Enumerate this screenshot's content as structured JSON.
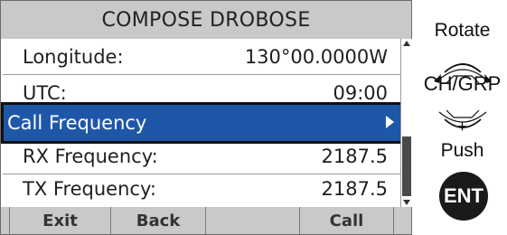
{
  "screen": {
    "title": "COMPOSE DROBOSE",
    "rows": [
      {
        "label": "Longitude:",
        "value": "130°00.0000W"
      },
      {
        "label": "UTC:",
        "value": "09:00"
      },
      {
        "label": "Call Frequency",
        "value": ""
      },
      {
        "label": "RX Frequency:",
        "value": "2187.5"
      },
      {
        "label": "TX Frequency:",
        "value": "2187.5"
      }
    ],
    "softkeys": [
      "Exit",
      "Back",
      "",
      "Call",
      ""
    ]
  },
  "controls": {
    "rotate_label": "Rotate",
    "knob_label": "CH/GRP",
    "plus_label": "+",
    "push_label": "Push",
    "ent_label": "ENT"
  },
  "colors": {
    "selection": "#1e57a8",
    "title_bar": "#c9c9c9"
  }
}
